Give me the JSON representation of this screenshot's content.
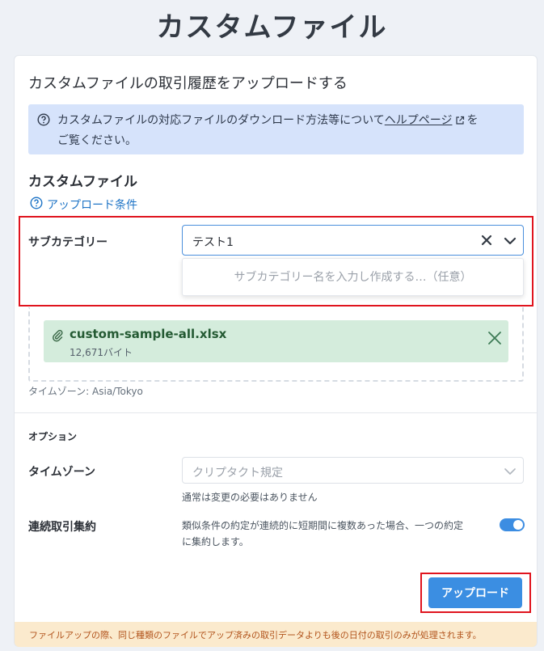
{
  "page": {
    "title": "カスタムファイル"
  },
  "card": {
    "title": "カスタムファイルの取引履歴をアップロードする"
  },
  "info": {
    "text_before": "カスタムファイルの対応ファイルのダウンロード方法等について",
    "link_label": "ヘルプページ",
    "text_after": "を",
    "line2": "ご覧ください。"
  },
  "custom_file": {
    "section_title": "カスタムファイル",
    "conditions_link": "アップロード条件"
  },
  "subcategory": {
    "label": "サブカテゴリー",
    "value": "テスト1",
    "dropdown_placeholder": "サブカテゴリー名を入力し作成する…（任意）"
  },
  "file": {
    "name": "custom-sample-all.xlsx",
    "size": "12,671バイト"
  },
  "timezone_note": "タイムゾーン: Asia/Tokyo",
  "options": {
    "title": "オプション",
    "timezone": {
      "label": "タイムゾーン",
      "placeholder": "クリプタクト規定",
      "help": "通常は変更の必要はありません"
    },
    "consolidate": {
      "label": "連続取引集約",
      "desc_line1": "類似条件の約定が連続的に短期間に複数あった場合、一つの約定",
      "desc_line2": "に集約します。",
      "enabled": true
    }
  },
  "upload_button": "アップロード",
  "footer": "ファイルアップの際、同じ種類のファイルでアップ済みの取引データよりも後の日付の取引のみが処理されます。",
  "colors": {
    "accent": "#3b8ee2",
    "info_bg": "#d6e3fb",
    "file_bg": "#d4ecdc",
    "footer_bg": "#fbeacd",
    "highlight_red": "#e0141e"
  }
}
